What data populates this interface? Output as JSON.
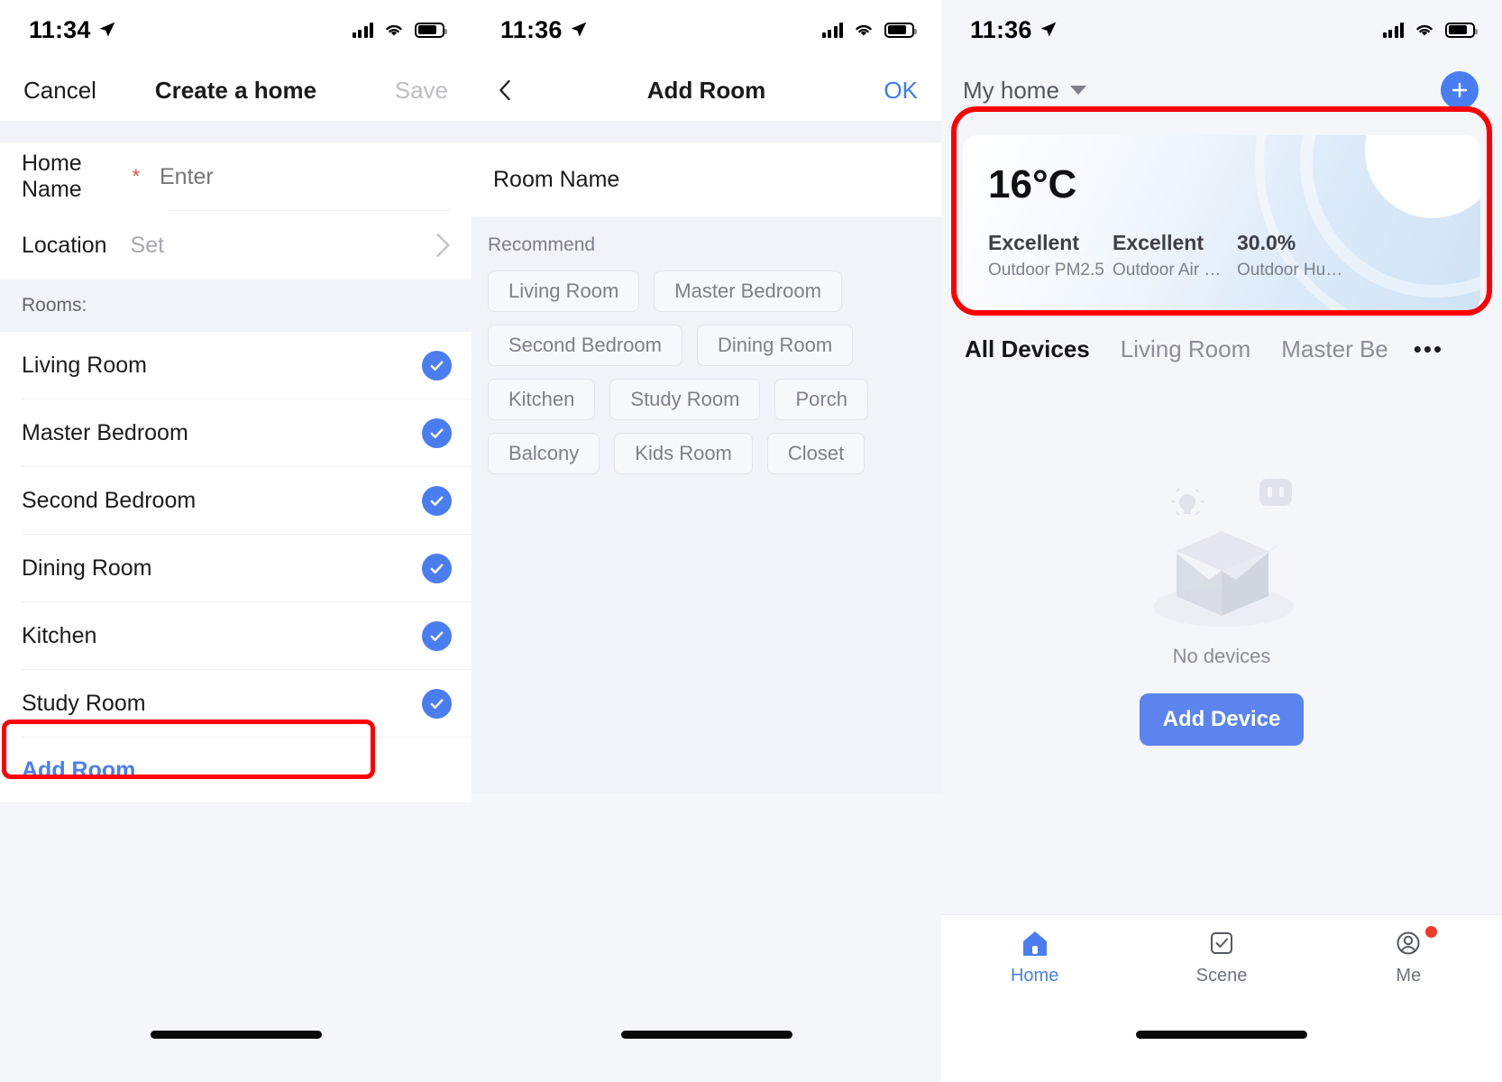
{
  "panel_create_home": {
    "status_bar": {
      "time": "11:34",
      "location_icon": "location-arrow-icon",
      "signal_icon": "cellular-signal-icon",
      "wifi_icon": "wifi-icon",
      "battery_icon": "battery-icon"
    },
    "nav": {
      "left_label": "Cancel",
      "title": "Create a home",
      "right_label": "Save"
    },
    "form": {
      "home_name_label": "Home Name",
      "home_name_required_marker": "*",
      "home_name_value": "",
      "home_name_placeholder": "Enter",
      "location_label": "Location",
      "location_value": "Set",
      "chevron_icon": "chevron-right-icon"
    },
    "rooms_section_title": "Rooms:",
    "rooms": [
      {
        "name": "Living Room",
        "selected": true
      },
      {
        "name": "Master Bedroom",
        "selected": true
      },
      {
        "name": "Second Bedroom",
        "selected": true
      },
      {
        "name": "Dining Room",
        "selected": true
      },
      {
        "name": "Kitchen",
        "selected": true
      },
      {
        "name": "Study Room",
        "selected": true
      }
    ],
    "add_room_label": "Add Room",
    "add_room_highlight_color": "#ff0000"
  },
  "panel_add_room": {
    "status_bar": {
      "time": "11:36"
    },
    "nav": {
      "back_icon": "chevron-left-icon",
      "title": "Add Room",
      "right_label": "OK"
    },
    "room_name_label": "Room Name",
    "room_name_value": "",
    "recommend_title": "Recommend",
    "recommend_chips": [
      "Living Room",
      "Master Bedroom",
      "Second Bedroom",
      "Dining Room",
      "Kitchen",
      "Study Room",
      "Porch",
      "Balcony",
      "Kids Room",
      "Closet"
    ]
  },
  "panel_home": {
    "status_bar": {
      "time": "11:36"
    },
    "home_selector_label": "My home",
    "home_selector_icon": "chevron-down-icon",
    "add_button_icon": "plus-icon",
    "weather": {
      "temperature": "16°C",
      "metrics": [
        {
          "value": "Excellent",
          "label": "Outdoor PM2.5"
        },
        {
          "value": "Excellent",
          "label": "Outdoor Air Qu..."
        },
        {
          "value": "30.0%",
          "label": "Outdoor Humid..."
        }
      ],
      "highlight_color": "#ff0000"
    },
    "tabs": [
      {
        "label": "All Devices",
        "active": true
      },
      {
        "label": "Living Room",
        "active": false
      },
      {
        "label": "Master Be",
        "active": false
      }
    ],
    "tabs_more_icon": "ellipsis-icon",
    "empty_state": {
      "illustration": "empty-box-illustration",
      "text": "No devices",
      "button_label": "Add Device",
      "button_color": "#5b84ef"
    },
    "tabbar": [
      {
        "label": "Home",
        "icon": "home-icon",
        "active": true,
        "badge": false
      },
      {
        "label": "Scene",
        "icon": "checkbox-icon",
        "active": false,
        "badge": false
      },
      {
        "label": "Me",
        "icon": "account-icon",
        "active": false,
        "badge": true
      }
    ]
  }
}
